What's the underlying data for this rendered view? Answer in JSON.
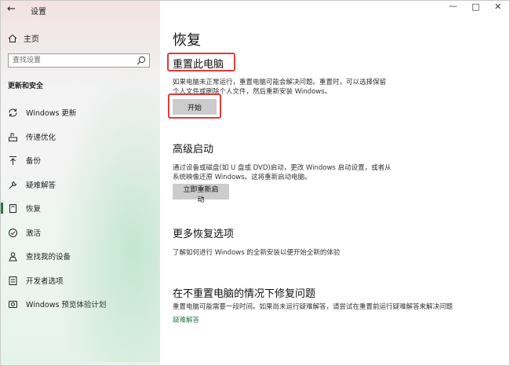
{
  "window": {
    "title": "设置"
  },
  "sidebar": {
    "home_label": "主页",
    "search_placeholder": "查找设置",
    "section_label": "更新和安全",
    "items": [
      {
        "label": "Windows 更新",
        "icon": "sync-icon"
      },
      {
        "label": "传递优化",
        "icon": "delivery-optimization-icon"
      },
      {
        "label": "备份",
        "icon": "backup-icon"
      },
      {
        "label": "疑难解答",
        "icon": "wrench-icon"
      },
      {
        "label": "恢复",
        "icon": "recovery-icon"
      },
      {
        "label": "激活",
        "icon": "activation-icon"
      },
      {
        "label": "查找我的设备",
        "icon": "find-device-icon"
      },
      {
        "label": "开发者选项",
        "icon": "developer-icon"
      },
      {
        "label": "Windows 预览体验计划",
        "icon": "insider-icon"
      }
    ],
    "active_item": "恢复"
  },
  "main": {
    "page_title": "恢复",
    "reset": {
      "title": "重置此电脑",
      "desc_line1": "如果电脑未正常运行，重置电脑可能会解决问题。重置时，可以选择保留",
      "desc_line2": "个人文件或删除个人文件，然后重新安装 Windows。",
      "button": "开始"
    },
    "advanced": {
      "title": "高级启动",
      "desc_line1": "通过设备或磁盘(如 U 盘或 DVD)启动，更改 Windows 启动设置，或者从",
      "desc_line2": "系统映像还原 Windows。这将重新启动电脑。",
      "button": "立即重新启动"
    },
    "more": {
      "title": "更多恢复选项",
      "desc": "了解如何进行 Windows 的全新安装以便开始全新的体验"
    },
    "fix": {
      "title": "在不重置电脑的情况下修复问题",
      "desc": "重置电脑可能需要一段时间。如果尚未运行疑难解答，请尝试在重置前运行疑难解答来解决问题",
      "link": "疑难解答"
    }
  },
  "colors": {
    "accent": "#1f7a3a",
    "highlight": "#e23a3a",
    "button": "#cccccc"
  }
}
